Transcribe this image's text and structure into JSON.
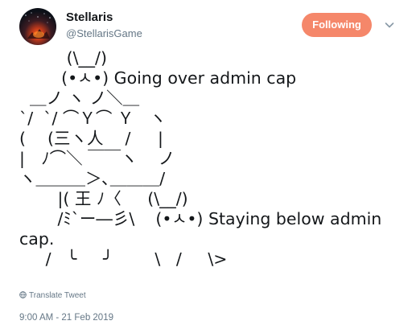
{
  "author": {
    "display_name": "Stellaris",
    "handle": "@StellarisGame"
  },
  "follow_button": {
    "label": "Following",
    "color": "#f5876a"
  },
  "menu_icon": "chevron-down-icon",
  "tweet": {
    "text": "         (\\__/)\n        (•ㅅ•) Going over admin cap\n  ＿ノ ヽ ノ＼＿\n`/  `/ ⌒Ｙ⌒ Ｙ   ヽ\n( 　(三ヽ人　 /　  |\n|　ﾉ⌒＼ ￣￣ヽ    ノ\nヽ＿＿＿＞､＿＿＿/\n　 　|( 王 ﾉ〈     (\\__/)\n　 　/ﾐ`ー―彡\\    (•ㅅ•) Staying below admin\ncap.\n     /   ╰     ╯        \\   /     \\>"
  },
  "translate_link": "Translate Tweet",
  "timestamp": "9:00 AM - 21 Feb 2019"
}
